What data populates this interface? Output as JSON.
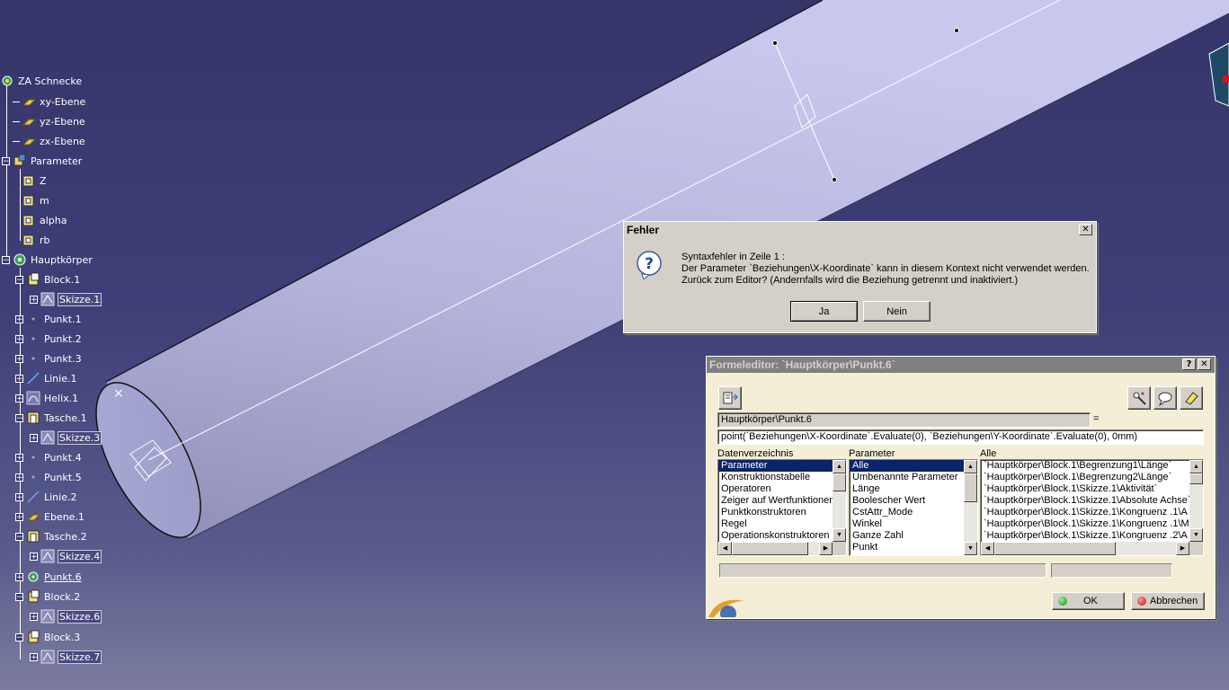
{
  "tree": {
    "root": "ZA Schnecke",
    "planes": [
      "xy-Ebene",
      "yz-Ebene",
      "zx-Ebene"
    ],
    "parameter_group": "Parameter",
    "parameters": [
      "Z",
      "m",
      "alpha",
      "rb"
    ],
    "body": "Hauptkörper",
    "items": [
      {
        "label": "Block.1",
        "icon": "pad-icon"
      },
      {
        "label": "Skizze.1",
        "icon": "sketch-icon"
      },
      {
        "label": "Punkt.1",
        "icon": "point-icon"
      },
      {
        "label": "Punkt.2",
        "icon": "point-icon"
      },
      {
        "label": "Punkt.3",
        "icon": "point-icon"
      },
      {
        "label": "Linie.1",
        "icon": "line-icon"
      },
      {
        "label": "Helix.1",
        "icon": "helix-icon"
      },
      {
        "label": "Tasche.1",
        "icon": "pocket-icon"
      },
      {
        "label": "Skizze.3",
        "icon": "sketch-icon"
      },
      {
        "label": "Punkt.4",
        "icon": "point-icon"
      },
      {
        "label": "Punkt.5",
        "icon": "point-icon"
      },
      {
        "label": "Linie.2",
        "icon": "line-icon"
      },
      {
        "label": "Ebene.1",
        "icon": "plane-icon"
      },
      {
        "label": "Tasche.2",
        "icon": "pocket-icon"
      },
      {
        "label": "Skizze.4",
        "icon": "sketch-icon"
      },
      {
        "label": "Punkt.6",
        "icon": "point-icon"
      },
      {
        "label": "Block.2",
        "icon": "pad-icon"
      },
      {
        "label": "Skizze.6",
        "icon": "sketch-icon"
      },
      {
        "label": "Block.3",
        "icon": "pad-icon"
      },
      {
        "label": "Skizze.7",
        "icon": "sketch-icon"
      }
    ]
  },
  "error_dialog": {
    "title": "Fehler",
    "close": "✕",
    "line1": "Syntaxfehler in Zeile 1 :",
    "line2": " Der Parameter `Beziehungen\\X-Koordinate` kann in diesem Kontext nicht verwendet werden.",
    "line3": "Zurück zum Editor? (Andernfalls wird die Beziehung getrennt und inaktiviert.)",
    "yes": "Ja",
    "no": "Nein"
  },
  "formula_editor": {
    "title": "Formeleditor: `Hauptkörper\\Punkt.6`",
    "help": "?",
    "close": "✕",
    "target": "Hauptkörper\\Punkt.6",
    "equals": "=",
    "formula": "point(`Beziehungen\\X-Koordinate`.Evaluate(0), `Beziehungen\\Y-Koordinate`.Evaluate(0), 0mm)",
    "col1_label": "Datenverzeichnis",
    "col2_label": "Parameter",
    "col3_label": "Alle",
    "dictionary": [
      "Parameter",
      "Konstruktionstabelle",
      "Operatoren",
      "Zeiger auf Wertfunktionen",
      "Punktkonstruktoren",
      "Regel",
      "Operationskonstruktoren"
    ],
    "parameter_types": [
      "Alle",
      "Umbenannte Parameter",
      "Länge",
      "Boolescher Wert",
      "CstAttr_Mode",
      "Winkel",
      "Ganze Zahl",
      "Punkt"
    ],
    "all_params": [
      "`Hauptkörper\\Block.1\\Begrenzung1\\Länge`",
      "`Hauptkörper\\Block.1\\Begrenzung2\\Länge`",
      "`Hauptkörper\\Block.1\\Skizze.1\\Aktivität`",
      "`Hauptkörper\\Block.1\\Skizze.1\\Absolute Achse`",
      "`Hauptkörper\\Block.1\\Skizze.1\\Kongruenz .1\\A",
      "`Hauptkörper\\Block.1\\Skizze.1\\Kongruenz .1\\M",
      "`Hauptkörper\\Block.1\\Skizze.1\\Kongruenz .2\\A"
    ],
    "ok": "OK",
    "cancel": "Abbrechen"
  },
  "colors": {
    "selection": "#0a246a",
    "dialog": "#d4d0c8",
    "title_active": "#0a246a",
    "title_inactive": "#808080"
  }
}
